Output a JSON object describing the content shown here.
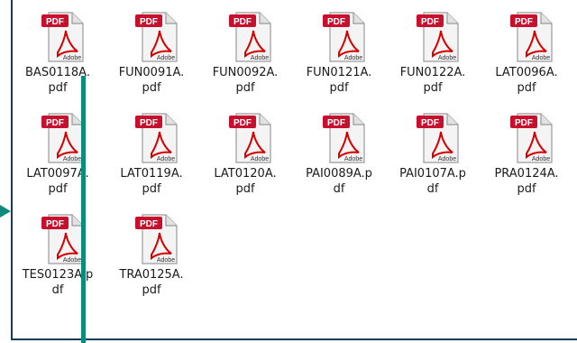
{
  "explorer": {
    "files": [
      {
        "name": "BAS0118A.\npdf",
        "type_badge": "PDF",
        "brand": "Adobe",
        "icon": "pdf-file-icon"
      },
      {
        "name": "FUN0091A.\npdf",
        "type_badge": "PDF",
        "brand": "Adobe",
        "icon": "pdf-file-icon"
      },
      {
        "name": "FUN0092A.\npdf",
        "type_badge": "PDF",
        "brand": "Adobe",
        "icon": "pdf-file-icon"
      },
      {
        "name": "FUN0121A.\npdf",
        "type_badge": "PDF",
        "brand": "Adobe",
        "icon": "pdf-file-icon"
      },
      {
        "name": "FUN0122A.\npdf",
        "type_badge": "PDF",
        "brand": "Adobe",
        "icon": "pdf-file-icon"
      },
      {
        "name": "LAT0096A.\npdf",
        "type_badge": "PDF",
        "brand": "Adobe",
        "icon": "pdf-file-icon"
      },
      {
        "name": "LAT0097A.\npdf",
        "type_badge": "PDF",
        "brand": "Adobe",
        "icon": "pdf-file-icon"
      },
      {
        "name": "LAT0119A.\npdf",
        "type_badge": "PDF",
        "brand": "Adobe",
        "icon": "pdf-file-icon"
      },
      {
        "name": "LAT0120A.\npdf",
        "type_badge": "PDF",
        "brand": "Adobe",
        "icon": "pdf-file-icon"
      },
      {
        "name": "PAI0089A.p\ndf",
        "type_badge": "PDF",
        "brand": "Adobe",
        "icon": "pdf-file-icon"
      },
      {
        "name": "PAI0107A.p\ndf",
        "type_badge": "PDF",
        "brand": "Adobe",
        "icon": "pdf-file-icon"
      },
      {
        "name": "PRA0124A.\npdf",
        "type_badge": "PDF",
        "brand": "Adobe",
        "icon": "pdf-file-icon"
      },
      {
        "name": "TES0123A.p\ndf",
        "type_badge": "PDF",
        "brand": "Adobe",
        "icon": "pdf-file-icon"
      },
      {
        "name": "TRA0125A.\npdf",
        "type_badge": "PDF",
        "brand": "Adobe",
        "icon": "pdf-file-icon"
      }
    ]
  },
  "colors": {
    "pdf_badge": "#c8102e",
    "adobe_swoosh": "#d40000",
    "annotation_teal": "#0e8a7e",
    "frame_border": "#1a3a5a"
  }
}
